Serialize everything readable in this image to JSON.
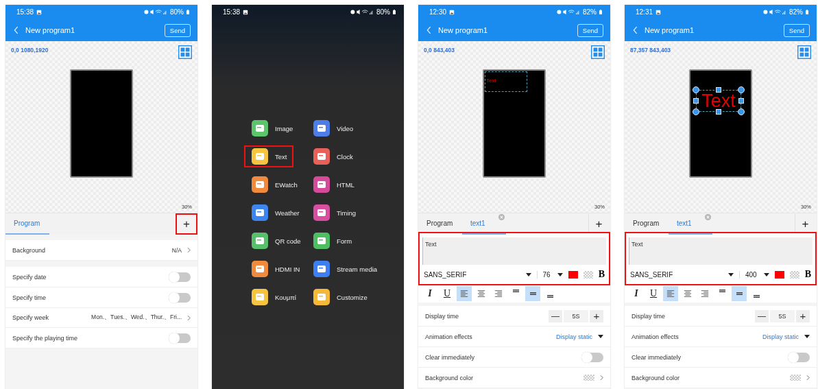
{
  "screens": [
    {
      "kind": "program",
      "status": {
        "time": "15:38",
        "battery": "80%"
      },
      "header": {
        "title": "New program1",
        "action": "Send"
      },
      "canvas": {
        "coords": "0,0 1080,1920",
        "zoom": "30%"
      },
      "tabs": [
        {
          "label": "Program",
          "selected": true,
          "closable": false
        }
      ],
      "add": "+",
      "add_highlighted": true,
      "rows": [
        {
          "kind": "link",
          "label": "Background",
          "value": "N/A"
        },
        {
          "kind": "toggle",
          "label": "Specify date",
          "on": false
        },
        {
          "kind": "toggle",
          "label": "Specify time",
          "on": false
        },
        {
          "kind": "link",
          "label": "Specify week",
          "value": "Mon.、Tues.、Wed.、Thur.、Fri..."
        },
        {
          "kind": "toggle",
          "label": "Specify the playing time",
          "on": false
        }
      ]
    },
    {
      "kind": "menu",
      "status": {
        "time": "15:38",
        "battery": "80%"
      },
      "items": [
        {
          "label": "Image",
          "color": "#5cc46a",
          "highlighted": false
        },
        {
          "label": "Video",
          "color": "#4c7de8",
          "highlighted": false
        },
        {
          "label": "Text",
          "color": "#f5c542",
          "highlighted": true
        },
        {
          "label": "Clock",
          "color": "#e8605a",
          "highlighted": false
        },
        {
          "label": "EWatch",
          "color": "#f08a3c",
          "highlighted": false
        },
        {
          "label": "HTML",
          "color": "#d64a9a",
          "highlighted": false
        },
        {
          "label": "Weather",
          "color": "#3d86f0",
          "highlighted": false
        },
        {
          "label": "Timing",
          "color": "#d84ea0",
          "highlighted": false
        },
        {
          "label": "QR code",
          "color": "#58c06a",
          "highlighted": false
        },
        {
          "label": "Form",
          "color": "#4fbe62",
          "highlighted": false
        },
        {
          "label": "HDMI IN",
          "color": "#f08a3c",
          "highlighted": false
        },
        {
          "label": "Stream media",
          "color": "#3f7ef0",
          "highlighted": false
        },
        {
          "label": "Κουμπί",
          "color": "#f5c542",
          "highlighted": false
        },
        {
          "label": "Customize",
          "color": "#f5b838",
          "highlighted": false
        }
      ]
    },
    {
      "kind": "editor",
      "status": {
        "time": "12:30",
        "battery": "82%"
      },
      "header": {
        "title": "New program1",
        "action": "Send"
      },
      "canvas": {
        "coords": "0,0 843,403",
        "zoom": "30%",
        "element": {
          "text": "Text",
          "kind": "small",
          "selected": false
        }
      },
      "tabs": [
        {
          "label": "Program",
          "selected": false,
          "closable": false
        },
        {
          "label": "text1",
          "selected": true,
          "closable": true
        }
      ],
      "add": "+",
      "add_highlighted": false,
      "editor_highlighted": true,
      "text_value": "Text",
      "font": "SANS_SERIF",
      "font_size": "76",
      "bold": "B",
      "format": [
        {
          "kind": "italic",
          "label": "I",
          "selected": false
        },
        {
          "kind": "underline",
          "label": "U",
          "selected": false
        },
        {
          "kind": "align-left",
          "selected": true
        },
        {
          "kind": "align-center",
          "selected": false
        },
        {
          "kind": "align-right",
          "selected": false
        },
        {
          "kind": "valign-top",
          "selected": false
        },
        {
          "kind": "valign-middle",
          "selected": true
        },
        {
          "kind": "valign-bottom",
          "selected": false
        }
      ],
      "rows": [
        {
          "kind": "stepper",
          "label": "Display time",
          "minus": "—",
          "value": "5S",
          "plus": "+"
        },
        {
          "kind": "dropdown",
          "label": "Animation effects",
          "value": "Display static"
        },
        {
          "kind": "toggle",
          "label": "Clear immediately",
          "on": false
        },
        {
          "kind": "swatch",
          "label": "Background color"
        }
      ]
    },
    {
      "kind": "editor",
      "status": {
        "time": "12:31",
        "battery": "82%"
      },
      "header": {
        "title": "New program1",
        "action": "Send"
      },
      "canvas": {
        "coords": "87,357 843,403",
        "zoom": "30%",
        "element": {
          "text": "Text",
          "kind": "large",
          "selected": true
        }
      },
      "tabs": [
        {
          "label": "Program",
          "selected": false,
          "closable": false
        },
        {
          "label": "text1",
          "selected": true,
          "closable": true
        }
      ],
      "add": "+",
      "add_highlighted": false,
      "editor_highlighted": true,
      "text_value": "Text",
      "font": "SANS_SERIF",
      "font_size": "400",
      "bold": "B",
      "format": [
        {
          "kind": "italic",
          "label": "I",
          "selected": false
        },
        {
          "kind": "underline",
          "label": "U",
          "selected": false
        },
        {
          "kind": "align-left",
          "selected": true
        },
        {
          "kind": "align-center",
          "selected": false
        },
        {
          "kind": "align-right",
          "selected": false
        },
        {
          "kind": "valign-top",
          "selected": false
        },
        {
          "kind": "valign-middle",
          "selected": true
        },
        {
          "kind": "valign-bottom",
          "selected": false
        }
      ],
      "rows": [
        {
          "kind": "stepper",
          "label": "Display time",
          "minus": "—",
          "value": "5S",
          "plus": "+"
        },
        {
          "kind": "dropdown",
          "label": "Animation effects",
          "value": "Display static"
        },
        {
          "kind": "toggle",
          "label": "Clear immediately",
          "on": false
        },
        {
          "kind": "swatch",
          "label": "Background color"
        }
      ]
    }
  ]
}
